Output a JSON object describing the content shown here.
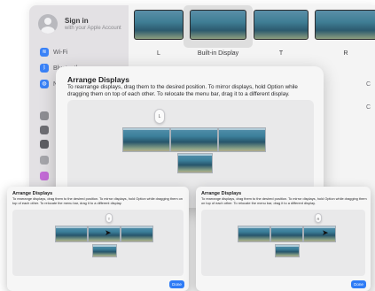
{
  "background_window": {
    "account": {
      "title": "Sign in",
      "subtitle": "with your Apple Account"
    },
    "sidebar_items": [
      {
        "label": "Wi-Fi",
        "icon": "wifi-icon",
        "color": "#3a82f7"
      },
      {
        "label": "Bluetooth",
        "icon": "bluetooth-icon",
        "color": "#3a82f7"
      },
      {
        "label": "N",
        "icon": "network-icon",
        "color": "#3a82f7"
      }
    ],
    "displays": [
      {
        "label": "L"
      },
      {
        "label": "Built-in Display"
      },
      {
        "label": "T"
      },
      {
        "label": "R"
      }
    ],
    "row_letters": [
      "C",
      "C"
    ]
  },
  "dialog": {
    "title": "Arrange Displays",
    "description": "To rearrange displays, drag them to the desired position. To mirror displays, hold Option while dragging them on top of each other. To relocate the menu bar, drag it to a different display.",
    "mouse_badge": "L"
  },
  "mini_left": {
    "title": "Arrange Displays",
    "description": "To rearrange displays, drag them to the desired position. To mirror displays, hold Option while dragging them on top of each other. To relocate the menu bar, drag it to a different display.",
    "mouse_badge": "T",
    "done_label": "Done"
  },
  "mini_right": {
    "title": "Arrange Displays",
    "description": "To rearrange displays, drag them to the desired position. To mirror displays, hold Option while dragging them on top of each other. To relocate the menu bar, drag it to a different display.",
    "mouse_badge": "R",
    "done_label": "Done"
  },
  "colors": {
    "accent": "#2f7cf6"
  }
}
